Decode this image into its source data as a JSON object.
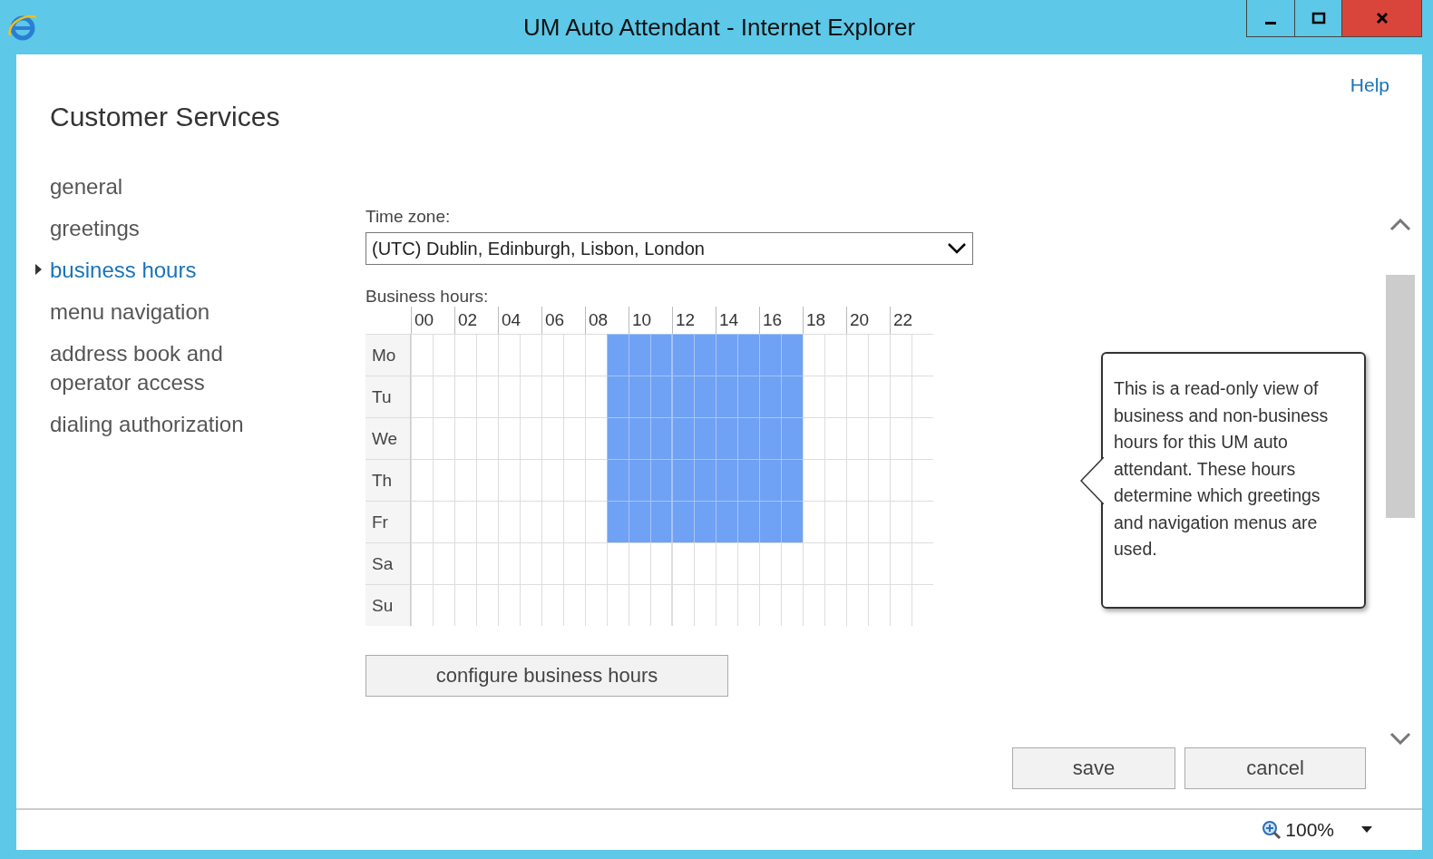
{
  "window": {
    "title": "UM Auto Attendant - Internet Explorer"
  },
  "help": "Help",
  "page_title": "Customer Services",
  "nav": [
    {
      "label": "general",
      "selected": false
    },
    {
      "label": "greetings",
      "selected": false
    },
    {
      "label": "business hours",
      "selected": true
    },
    {
      "label": "menu navigation",
      "selected": false
    },
    {
      "label": "address book and operator access",
      "selected": false
    },
    {
      "label": "dialing authorization",
      "selected": false
    }
  ],
  "time_zone": {
    "label": "Time zone:",
    "value": "(UTC) Dublin, Edinburgh, Lisbon, London"
  },
  "business_hours": {
    "label": "Business hours:",
    "hour_labels": [
      "00",
      "02",
      "04",
      "06",
      "08",
      "10",
      "12",
      "14",
      "16",
      "18",
      "20",
      "22"
    ],
    "days": [
      {
        "name": "Mo",
        "slots": [
          false,
          false,
          false,
          false,
          false,
          false,
          false,
          false,
          false,
          true,
          true,
          true,
          true,
          true,
          true,
          true,
          true,
          true,
          false,
          false,
          false,
          false,
          false,
          false
        ]
      },
      {
        "name": "Tu",
        "slots": [
          false,
          false,
          false,
          false,
          false,
          false,
          false,
          false,
          false,
          true,
          true,
          true,
          true,
          true,
          true,
          true,
          true,
          true,
          false,
          false,
          false,
          false,
          false,
          false
        ]
      },
      {
        "name": "We",
        "slots": [
          false,
          false,
          false,
          false,
          false,
          false,
          false,
          false,
          false,
          true,
          true,
          true,
          true,
          true,
          true,
          true,
          true,
          true,
          false,
          false,
          false,
          false,
          false,
          false
        ]
      },
      {
        "name": "Th",
        "slots": [
          false,
          false,
          false,
          false,
          false,
          false,
          false,
          false,
          false,
          true,
          true,
          true,
          true,
          true,
          true,
          true,
          true,
          true,
          false,
          false,
          false,
          false,
          false,
          false
        ]
      },
      {
        "name": "Fr",
        "slots": [
          false,
          false,
          false,
          false,
          false,
          false,
          false,
          false,
          false,
          true,
          true,
          true,
          true,
          true,
          true,
          true,
          true,
          true,
          false,
          false,
          false,
          false,
          false,
          false
        ]
      },
      {
        "name": "Sa",
        "slots": [
          false,
          false,
          false,
          false,
          false,
          false,
          false,
          false,
          false,
          false,
          false,
          false,
          false,
          false,
          false,
          false,
          false,
          false,
          false,
          false,
          false,
          false,
          false,
          false
        ]
      },
      {
        "name": "Su",
        "slots": [
          false,
          false,
          false,
          false,
          false,
          false,
          false,
          false,
          false,
          false,
          false,
          false,
          false,
          false,
          false,
          false,
          false,
          false,
          false,
          false,
          false,
          false,
          false,
          false
        ]
      }
    ]
  },
  "configure_button": "configure business hours",
  "tooltip": "This is a read-only view of business and non-business hours for this UM auto attendant. These hours determine which greetings and navigation menus are used.",
  "buttons": [
    "save",
    "cancel"
  ],
  "status_bar": {
    "zoom": "100%"
  }
}
